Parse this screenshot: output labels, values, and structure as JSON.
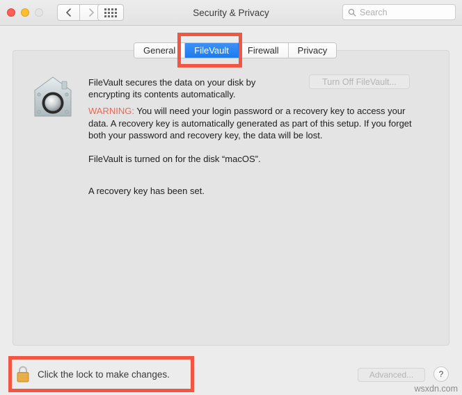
{
  "window": {
    "title": "Security & Privacy",
    "traffic_lights": [
      {
        "name": "close",
        "color": "#ff5f57",
        "enabled": true
      },
      {
        "name": "minimize",
        "color": "#ffbd2e",
        "enabled": true
      },
      {
        "name": "zoom",
        "color": "#e4e4e4",
        "enabled": false
      }
    ]
  },
  "toolbar": {
    "back_label": "‹",
    "forward_label": "›",
    "show_all_label": "Show All",
    "search": {
      "value": "",
      "placeholder": "Search"
    }
  },
  "tabs": [
    {
      "label": "General",
      "selected": false
    },
    {
      "label": "FileVault",
      "selected": true
    },
    {
      "label": "Firewall",
      "selected": false
    },
    {
      "label": "Privacy",
      "selected": false
    }
  ],
  "filevault": {
    "icon_name": "filevault-vault-icon",
    "description": "FileVault secures the data on your disk by encrypting its contents automatically.",
    "warning_label": "WARNING:",
    "warning_text": " You will need your login password or a recovery key to access your data. A recovery key is automatically generated as part of this setup. If you forget both your password and recovery key, the data will be lost.",
    "status_line_1": "FileVault is turned on for the disk “macOS”.",
    "status_line_2": "A recovery key has been set.",
    "turn_off_button": {
      "label": "Turn Off FileVault...",
      "enabled": false
    }
  },
  "bottom_bar": {
    "lock_icon_name": "padlock-locked-icon",
    "lock_text": "Click the lock to make changes.",
    "advanced_button": {
      "label": "Advanced...",
      "enabled": false
    },
    "help_button": {
      "label": "?"
    }
  },
  "watermark": "wsxdn.com",
  "annotations": [
    {
      "name": "filevault-tab-highlight",
      "color": "#f15642"
    },
    {
      "name": "lock-bar-highlight",
      "color": "#f15642"
    }
  ]
}
